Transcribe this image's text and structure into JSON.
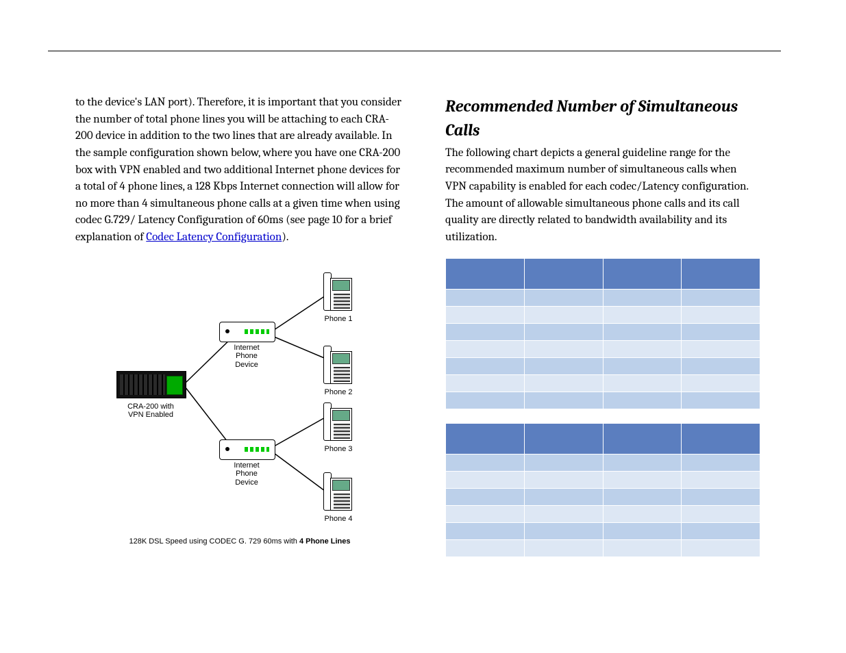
{
  "left": {
    "body_pre": "to the device's LAN port). Therefore, it is important that you consider the number of total phone lines you will be attaching to each CRA-200 device in addition to the two lines that are already available. In the sample configuration shown below, where you have one CRA-200 box with VPN enabled and two additional Internet phone devices for a total of 4 phone lines, a 128 Kbps Internet connection will allow for no more than 4 simultaneous phone calls at a given time when using codec G.729/ Latency Configuration of 60ms (see page 10 for a brief explanation of ",
    "link": "Codec Latency Configuration",
    "body_post": ")."
  },
  "diagram": {
    "router_label_l1": "CRA-200 with",
    "router_label_l2": "VPN Enabled",
    "ata_label_l1": "Internet",
    "ata_label_l2": "Phone",
    "ata_label_l3": "Device",
    "phone1": "Phone 1",
    "phone2": "Phone 2",
    "phone3": "Phone 3",
    "phone4": "Phone 4",
    "caption_pre": "128K DSL Speed using CODEC G. 729 60ms with ",
    "caption_bold": "4 Phone Lines"
  },
  "right": {
    "heading": "Recommended Number of Simultaneous Calls",
    "body": "The following chart depicts a general guideline range for the recommended maximum number of simultaneous calls when VPN capability is enabled for each codec/Latency configuration. The amount of allowable simultaneous phone calls and its call quality are directly related to bandwidth availability and its utilization."
  },
  "tables": {
    "t1": {
      "cols": 4,
      "rows": 7
    },
    "t2": {
      "cols": 4,
      "rows": 6
    }
  }
}
